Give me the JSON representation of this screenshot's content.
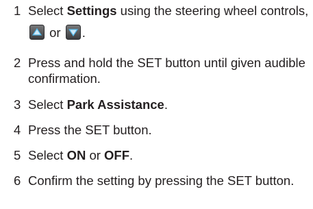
{
  "colors": {
    "text": "#231f20",
    "button_fill_top": "#6d6e70",
    "button_fill_bottom": "#3a3b3d",
    "button_arrow": "#4fb6e8"
  },
  "icons": {
    "up_button": "up-arrow-key-icon",
    "down_button": "down-arrow-key-icon"
  },
  "steps": [
    {
      "number": "1",
      "pre": "Select ",
      "bold": "Settings",
      "mid": " using the steering wheel controls, ",
      "or": " or ",
      "end": "."
    },
    {
      "number": "2",
      "text": "Press and hold the SET button until given audible confirmation."
    },
    {
      "number": "3",
      "pre": "Select ",
      "bold": "Park Assistance",
      "end": "."
    },
    {
      "number": "4",
      "text": "Press the SET button."
    },
    {
      "number": "5",
      "pre": "Select ",
      "bold1": "ON",
      "mid": " or ",
      "bold2": "OFF",
      "end": "."
    },
    {
      "number": "6",
      "text": "Confirm the setting by pressing the SET button."
    }
  ]
}
